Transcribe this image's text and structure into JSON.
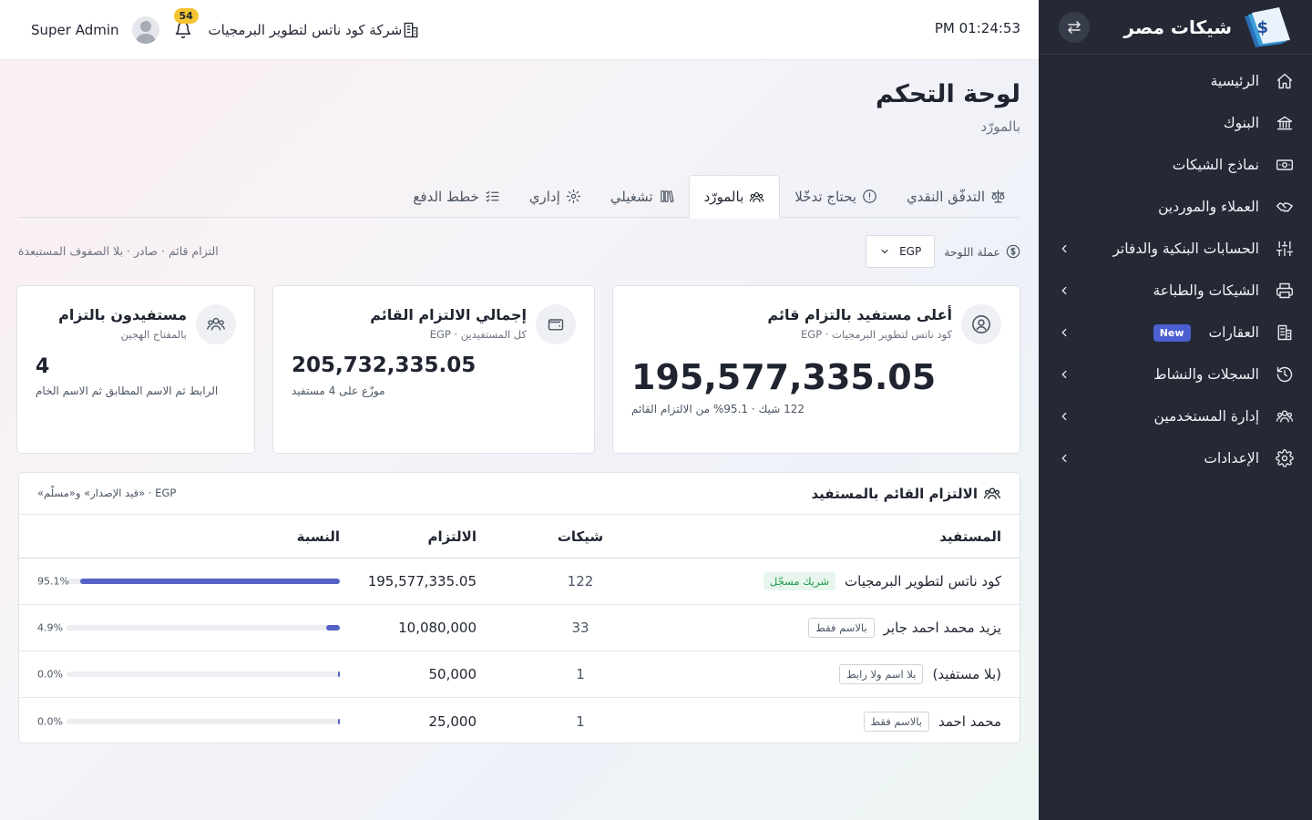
{
  "sidebar": {
    "brand": "شيكات مصر",
    "items": [
      {
        "label": "الرئيسية",
        "icon": "home-icon",
        "chevron": false
      },
      {
        "label": "البنوك",
        "icon": "bank-icon",
        "chevron": false
      },
      {
        "label": "نماذج الشيكات",
        "icon": "banknote-icon",
        "chevron": false
      },
      {
        "label": "العملاء والموردين",
        "icon": "handshake-icon",
        "chevron": false
      },
      {
        "label": "الحسابات البنكية والدفاتر",
        "icon": "sliders-icon",
        "chevron": true
      },
      {
        "label": "الشيكات والطباعة",
        "icon": "printer-icon",
        "chevron": true
      },
      {
        "label": "العقارات",
        "icon": "building-icon",
        "chevron": true,
        "badge": "New"
      },
      {
        "label": "السجلات والنشاط",
        "icon": "history-icon",
        "chevron": true
      },
      {
        "label": "إدارة المستخدمين",
        "icon": "users-icon",
        "chevron": true
      },
      {
        "label": "الإعدادات",
        "icon": "settings-icon",
        "chevron": true
      }
    ]
  },
  "topbar": {
    "clock": "PM 01:24:53",
    "company": "شركة كود ناتس لتطوير البرمجيات",
    "notification_count": "54",
    "user_name": "Super Admin"
  },
  "page": {
    "title": "لوحة التحكم",
    "subtitle": "بالمورّد"
  },
  "tabs": [
    {
      "label": "التدفّق النقدي",
      "icon": "scale-icon",
      "active": false
    },
    {
      "label": "يحتاج تدخّلا",
      "icon": "alert-circle-icon",
      "active": false
    },
    {
      "label": "بالمورّد",
      "icon": "users-icon",
      "active": true
    },
    {
      "label": "تشغيلي",
      "icon": "library-icon",
      "active": false
    },
    {
      "label": "إداري",
      "icon": "gear-icon",
      "active": false
    },
    {
      "label": "خطط الدفع",
      "icon": "list-checks-icon",
      "active": false
    }
  ],
  "currency": {
    "label": "عملة اللوحة",
    "value": "EGP"
  },
  "filter_note": "التزام قائم · صادر · بلا الصفوف المستبعدة",
  "cards": {
    "top_beneficiary": {
      "title": "أعلى مستفيد بالتزام قائم",
      "subtitle": "كود ناتس لتطوير البرمجيات · EGP",
      "value": "195,577,335.05",
      "note": "122 شيك · 95.1% من الالتزام القائم"
    },
    "total": {
      "title": "إجمالي الالتزام القائم",
      "subtitle": "كل المستفيدين · EGP",
      "value": "205,732,335.05",
      "note": "موزّع على 4 مستفيد"
    },
    "beneficiaries": {
      "title": "مستفيدون بالتزام",
      "subtitle": "بالمفتاح الهجين",
      "value": "4",
      "note": "الرابط ثم الاسم المطابق ثم الاسم الخام"
    }
  },
  "table": {
    "title": "الالتزام القائم بالمستفيد",
    "note": "EGP · «قيد الإصدار» و«مسلّم»",
    "columns": {
      "name": "المستفيد",
      "count": "شيكات",
      "amount": "الالتزام",
      "pct": "النسبة"
    },
    "rows": [
      {
        "name": "كود ناتس لتطوير البرمجيات",
        "tag": "شريك مسجّل",
        "tag_style": "green",
        "count": "122",
        "amount": "195,577,335.05",
        "pct_text": "95.1%",
        "pct": 0.951
      },
      {
        "name": "يزيد محمد احمد جابر",
        "tag": "بالاسم فقط",
        "tag_style": "gray",
        "count": "33",
        "amount": "10,080,000",
        "pct_text": "4.9%",
        "pct": 0.049
      },
      {
        "name": "(بلا مستفيد)",
        "tag": "بلا اسم ولا رابط",
        "tag_style": "gray",
        "count": "1",
        "amount": "50,000",
        "pct_text": "0.0%",
        "pct": 0.0
      },
      {
        "name": "محمد احمد",
        "tag": "بالاسم فقط",
        "tag_style": "gray",
        "count": "1",
        "amount": "25,000",
        "pct_text": "0.0%",
        "pct": 0.0
      }
    ]
  },
  "colors": {
    "sidebar_bg": "#242935",
    "accent": "#5462c6",
    "badge": "#f4c531",
    "new_badge": "#4b5fd1",
    "success": "#1f9a4d"
  }
}
